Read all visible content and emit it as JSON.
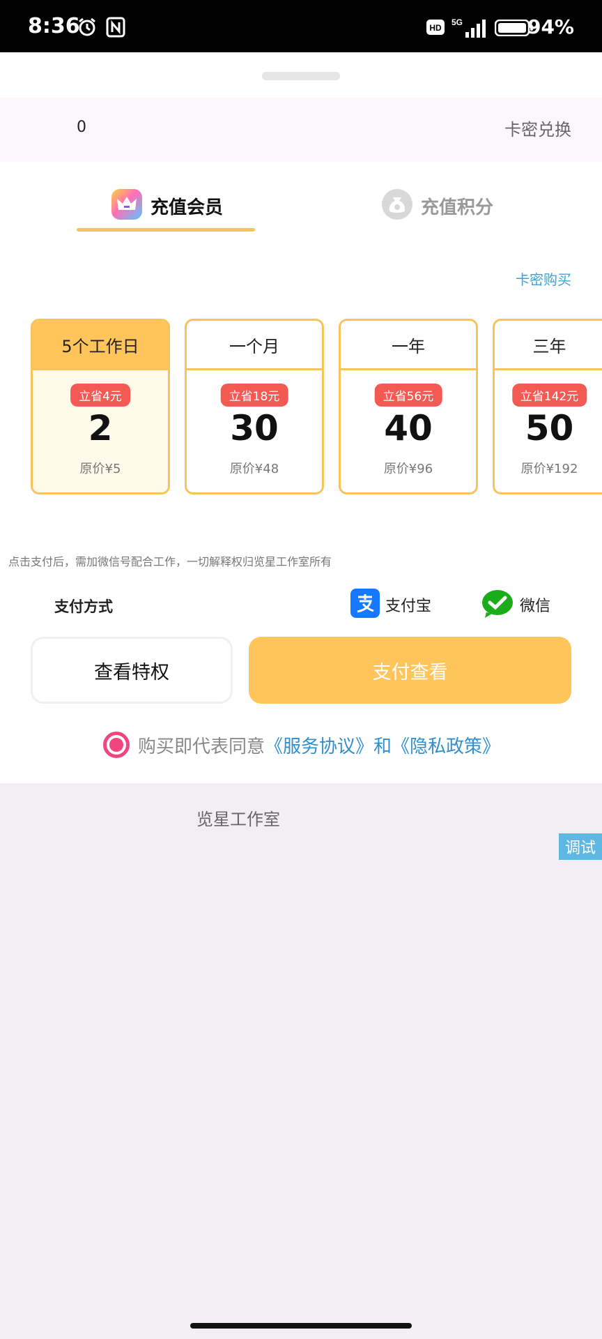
{
  "status_bar": {
    "time": "8:36",
    "battery": "94%",
    "network": "5G",
    "hd": "HD"
  },
  "top_bar": {
    "balance": "0",
    "redeem_label": "卡密兑换"
  },
  "tabs": [
    {
      "label": "充值会员",
      "active": true
    },
    {
      "label": "充值积分",
      "active": false
    }
  ],
  "buy_card_link": "卡密购买",
  "plans": [
    {
      "name": "5个工作日",
      "save": "立省4元",
      "price": "2",
      "original": "原价¥5",
      "selected": true
    },
    {
      "name": "一个月",
      "save": "立省18元",
      "price": "30",
      "original": "原价¥48",
      "selected": false
    },
    {
      "name": "一年",
      "save": "立省56元",
      "price": "40",
      "original": "原价¥96",
      "selected": false
    },
    {
      "name": "三年",
      "save": "立省142元",
      "price": "50",
      "original": "原价¥192",
      "selected": false
    }
  ],
  "notice": "点击支付后，需加微信号配合工作，一切解释权归览星工作室所有",
  "payment": {
    "label": "支付方式",
    "alipay": "支付宝",
    "wechat": "微信"
  },
  "buttons": {
    "view_privileges": "查看特权",
    "pay": "支付查看"
  },
  "agreement": {
    "prefix": "购买即代表同意",
    "service": "《服务协议》",
    "and": "和",
    "privacy": "《隐私政策》"
  },
  "footer": {
    "brand": "览星工作室",
    "debug": "调试"
  },
  "colors": {
    "accent": "#ffc45a",
    "badge": "#f25a53",
    "link": "#2f8fd0",
    "radio": "#f2447f"
  }
}
